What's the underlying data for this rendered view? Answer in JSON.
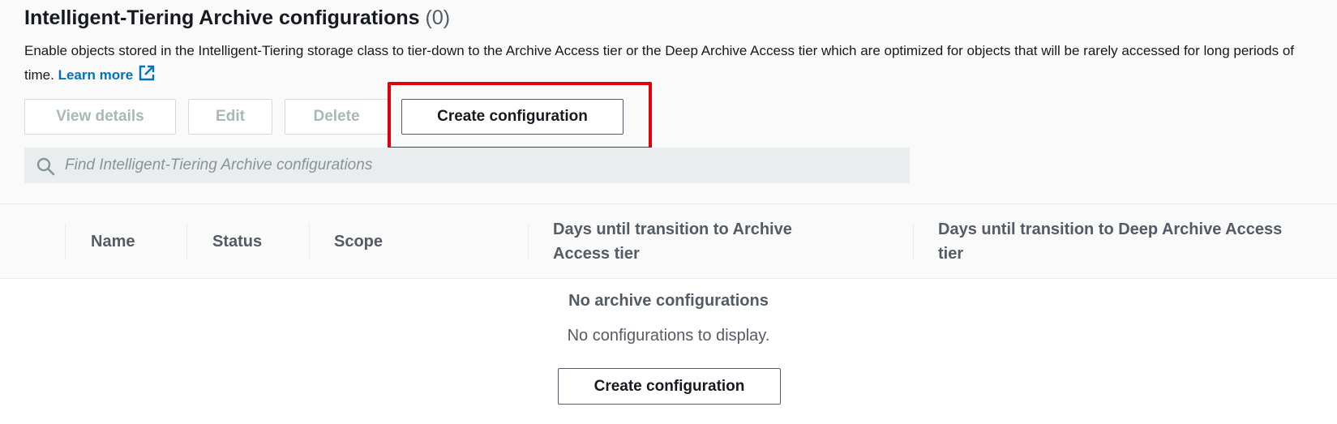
{
  "header": {
    "title": "Intelligent-Tiering Archive configurations",
    "count": "(0)",
    "description": "Enable objects stored in the Intelligent-Tiering storage class to tier-down to the Archive Access tier or the Deep Archive Access tier which are optimized for objects that will be rarely accessed for long periods of time.",
    "learn_more": "Learn more",
    "learn_more_icon": "external-link-icon"
  },
  "toolbar": {
    "view_details": "View details",
    "edit": "Edit",
    "delete": "Delete",
    "create": "Create configuration"
  },
  "search": {
    "placeholder": "Find Intelligent-Tiering Archive configurations",
    "value": "",
    "icon": "search-icon"
  },
  "table": {
    "columns": [
      "Name",
      "Status",
      "Scope",
      "Days until transition to Archive Access tier",
      "Days until transition to Deep Archive Access tier"
    ]
  },
  "empty_state": {
    "title": "No archive configurations",
    "message": "No configurations to display.",
    "button": "Create configuration"
  },
  "colors": {
    "link": "#0073bb",
    "highlight": "#e0000a",
    "disabled_text": "#aab7b8",
    "header_bg": "#fafafa"
  }
}
